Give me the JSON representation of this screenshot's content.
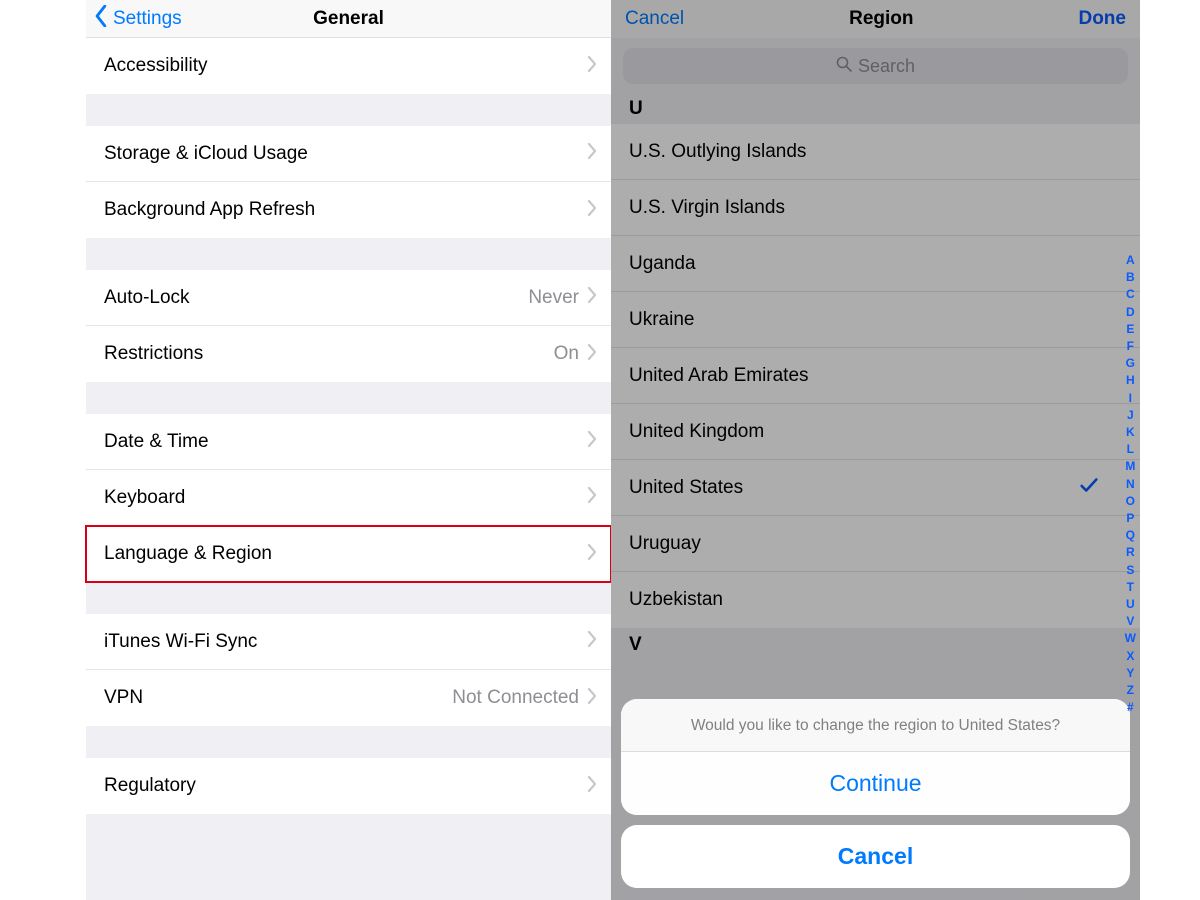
{
  "left": {
    "back_label": "Settings",
    "title": "General",
    "groups": [
      [
        {
          "label": "Accessibility"
        }
      ],
      [
        {
          "label": "Storage & iCloud Usage"
        },
        {
          "label": "Background App Refresh"
        }
      ],
      [
        {
          "label": "Auto-Lock",
          "value": "Never"
        },
        {
          "label": "Restrictions",
          "value": "On"
        }
      ],
      [
        {
          "label": "Date & Time"
        },
        {
          "label": "Keyboard"
        },
        {
          "label": "Language & Region",
          "highlight": true
        }
      ],
      [
        {
          "label": "iTunes Wi-Fi Sync"
        },
        {
          "label": "VPN",
          "value": "Not Connected"
        }
      ],
      [
        {
          "label": "Regulatory"
        }
      ]
    ]
  },
  "right": {
    "cancel": "Cancel",
    "title": "Region",
    "done": "Done",
    "search_placeholder": "Search",
    "section": "U",
    "regions": [
      {
        "name": "U.S. Outlying Islands"
      },
      {
        "name": "U.S. Virgin Islands"
      },
      {
        "name": "Uganda"
      },
      {
        "name": "Ukraine"
      },
      {
        "name": "United Arab Emirates"
      },
      {
        "name": "United Kingdom"
      },
      {
        "name": "United States",
        "selected": true
      },
      {
        "name": "Uruguay"
      },
      {
        "name": "Uzbekistan"
      }
    ],
    "next_section": "V",
    "index": [
      "A",
      "B",
      "C",
      "D",
      "E",
      "F",
      "G",
      "H",
      "I",
      "J",
      "K",
      "L",
      "M",
      "N",
      "O",
      "P",
      "Q",
      "R",
      "S",
      "T",
      "U",
      "V",
      "W",
      "X",
      "Y",
      "Z",
      "#"
    ],
    "sheet": {
      "message": "Would you like to change the region to United States?",
      "continue": "Continue",
      "cancel": "Cancel"
    }
  }
}
